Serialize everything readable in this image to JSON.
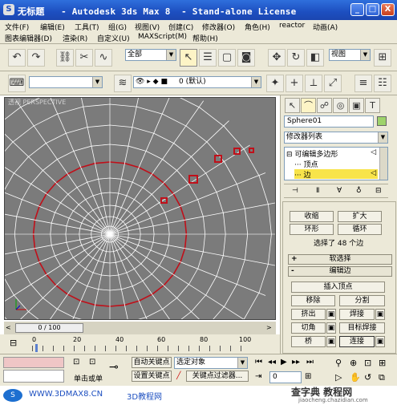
{
  "window": {
    "title": "无标题   - Autodesk 3ds Max 8  - Stand-alone License",
    "minimize": "_",
    "restore": "□",
    "close": "X"
  },
  "menus": {
    "row1": [
      "文件(F)",
      "编辑(E)",
      "工具(T)",
      "组(G)",
      "视图(V)",
      "创建(C)",
      "修改器(O)",
      "角色(H)",
      "reactor",
      "动画(A)"
    ],
    "row2": [
      "图表编辑器(D)",
      "渲染(R)",
      "自定义(U)",
      "MAXScript(M)",
      "帮助(H)"
    ]
  },
  "toolbar": {
    "selection_filter": "全部",
    "ref_coord": "视图",
    "named_selection": "",
    "layer": "0 (默认)"
  },
  "viewport": {
    "label": "透视 PERSPECTIVE"
  },
  "command_panel": {
    "object_name": "Sphere01",
    "modifier_list": "修改器列表",
    "stack": [
      "可编辑多边形",
      "顶点",
      "边"
    ],
    "selection": {
      "grow": "扩大",
      "shrink": "收缩",
      "ring": "环形",
      "loop": "循环",
      "status": "选择了 48 个边"
    },
    "rollouts": {
      "soft_selection": "软选择",
      "edit_edges": "编辑边"
    },
    "edit_edges": {
      "insert_vertex": "插入顶点",
      "remove": "移除",
      "split": "分割",
      "extrude": "挤出",
      "weld": "焊接",
      "chamfer": "切角",
      "target_weld": "目标焊接",
      "bridge": "桥",
      "connect": "连接"
    }
  },
  "timeline": {
    "frame_display": "0 / 100",
    "ticks": [
      "0",
      "20",
      "40",
      "60",
      "80",
      "100"
    ]
  },
  "status": {
    "mode": "单击或单",
    "auto_key": "自动关键点",
    "set_key": "设置关键点",
    "selected_object": "选定对象",
    "key_filters": "关键点过滤器...",
    "current_frame": "0"
  },
  "watermark": {
    "left": "WWW.3DMAX8.CN",
    "left2": "3D教程网",
    "right1": "查字典 教程网",
    "right2": "jiaocheng.chazidian.com"
  },
  "colors": {
    "titlebar": "#1d4fc0",
    "viewport_bg": "#7b7b7b",
    "wire": "#ffffff",
    "selected_edge": "#c0101a",
    "panel_bg": "#ece9d8",
    "stack_highlight": "#f8e44a"
  }
}
